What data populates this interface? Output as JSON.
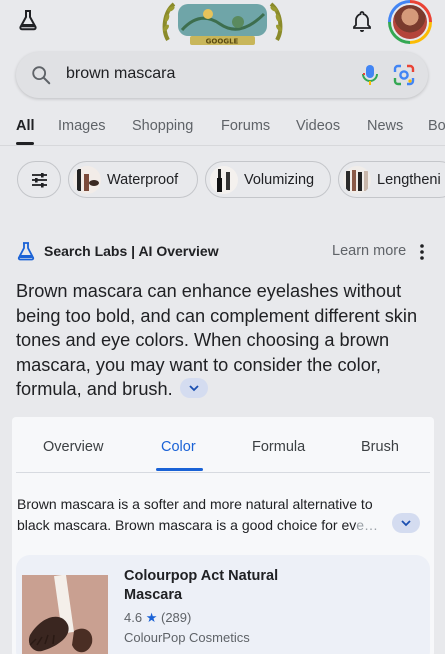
{
  "search": {
    "query": "brown mascara"
  },
  "tabs": [
    {
      "label": "All",
      "active": true
    },
    {
      "label": "Images"
    },
    {
      "label": "Shopping"
    },
    {
      "label": "Forums"
    },
    {
      "label": "Videos"
    },
    {
      "label": "News"
    },
    {
      "label": "Bo"
    }
  ],
  "chips": [
    {
      "label": "Waterproof"
    },
    {
      "label": "Volumizing"
    },
    {
      "label": "Lengtheni"
    }
  ],
  "ai_overview": {
    "title": "Search Labs | AI Overview",
    "learn_more": "Learn more",
    "summary": "Brown mascara can enhance eyelashes without being too bold, and can complement different skin tones and eye colors. When choosing a brown mascara, you may want to consider the color, formula, and brush."
  },
  "card": {
    "tabs": [
      "Overview",
      "Color",
      "Formula",
      "Brush"
    ],
    "active_tab": "Color",
    "body_main": "Brown mascara is a softer and more natural alternative to black mascara. Brown mascara is a good choice for ev",
    "body_fade": "e…",
    "product": {
      "title": "Colourpop Act Natural Mascara",
      "rating": "4.6",
      "reviews": "(289)",
      "brand": "ColourPop Cosmetics"
    }
  },
  "colors": {
    "background": "#e8e9ec",
    "accent_blue": "#1a62d6",
    "card_background": "#f7f8fa"
  }
}
